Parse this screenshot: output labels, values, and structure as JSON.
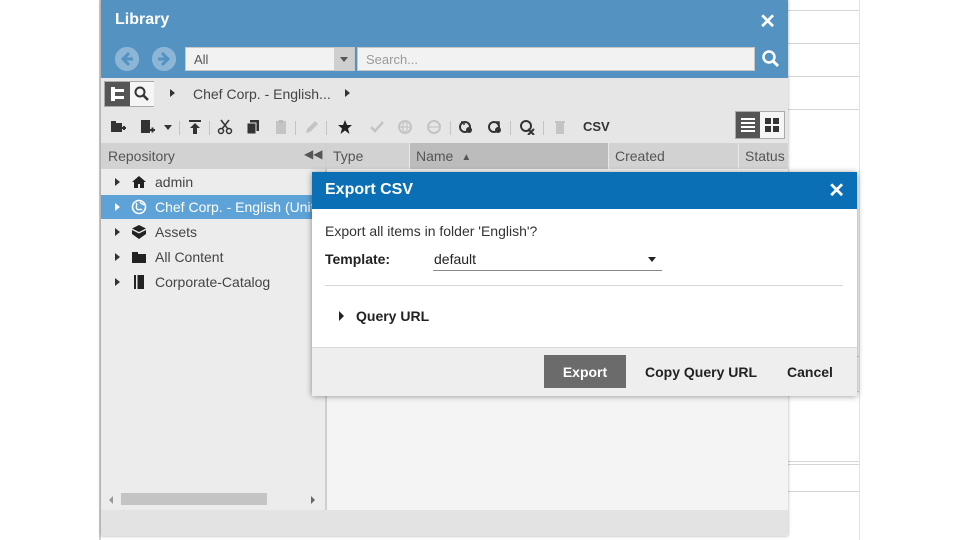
{
  "library": {
    "title": "Library",
    "filter_value": "All",
    "search_placeholder": "Search...",
    "breadcrumb": "Chef Corp. - English...",
    "csv_label": "CSV"
  },
  "tree": {
    "header": "Repository",
    "items": [
      {
        "label": "admin",
        "icon": "home-icon"
      },
      {
        "label": "Chef Corp. - English (United States)",
        "icon": "globe-icon",
        "selected": true
      },
      {
        "label": "Assets",
        "icon": "cube-icon"
      },
      {
        "label": "All Content",
        "icon": "folder-icon"
      },
      {
        "label": "Corporate-Catalog",
        "icon": "catalog-icon"
      }
    ]
  },
  "grid": {
    "columns": [
      "Type",
      "Name",
      "Created",
      "Status"
    ],
    "sorted_column": "Name"
  },
  "dialog": {
    "title": "Export CSV",
    "message": "Export all items in folder 'English'?",
    "template_label": "Template:",
    "template_value": "default",
    "query_url_label": "Query URL",
    "export_label": "Export",
    "copy_label": "Copy Query URL",
    "cancel_label": "Cancel"
  },
  "colors": {
    "library_header": "#5392c1",
    "dialog_header": "#0a6fb4",
    "selection": "#5ea3d7"
  }
}
